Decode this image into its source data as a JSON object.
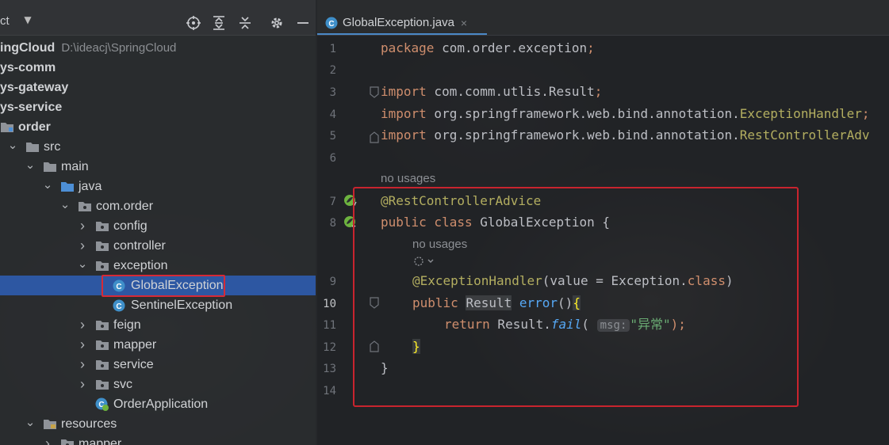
{
  "project_panel": {
    "title": "ct",
    "tree": [
      {
        "label": "ingCloud",
        "hint": "D:\\ideacj\\SpringCloud",
        "indent": 0,
        "arrow": "",
        "icon": "",
        "bold": true
      },
      {
        "label": "ys-comm",
        "indent": 0,
        "arrow": "",
        "icon": "",
        "bold": true
      },
      {
        "label": "ys-gateway",
        "indent": 0,
        "arrow": "",
        "icon": "",
        "bold": true
      },
      {
        "label": "ys-service",
        "indent": 0,
        "arrow": "",
        "icon": "",
        "bold": true
      },
      {
        "label": "order",
        "indent": 0,
        "arrow": "",
        "icon": "module",
        "bold": true
      },
      {
        "label": "src",
        "indent": 1,
        "arrow": "down",
        "icon": "folder"
      },
      {
        "label": "main",
        "indent": 2,
        "arrow": "down",
        "icon": "folder"
      },
      {
        "label": "java",
        "indent": 3,
        "arrow": "down",
        "icon": "folder-blue"
      },
      {
        "label": "com.order",
        "indent": 4,
        "arrow": "down",
        "icon": "package"
      },
      {
        "label": "config",
        "indent": 5,
        "arrow": "right",
        "icon": "package"
      },
      {
        "label": "controller",
        "indent": 5,
        "arrow": "right",
        "icon": "package"
      },
      {
        "label": "exception",
        "indent": 5,
        "arrow": "down",
        "icon": "package"
      },
      {
        "label": "GlobalException",
        "indent": 6,
        "arrow": "",
        "icon": "class",
        "selected": true
      },
      {
        "label": "SentinelException",
        "indent": 6,
        "arrow": "",
        "icon": "class"
      },
      {
        "label": "feign",
        "indent": 5,
        "arrow": "right",
        "icon": "package"
      },
      {
        "label": "mapper",
        "indent": 5,
        "arrow": "right",
        "icon": "package"
      },
      {
        "label": "service",
        "indent": 5,
        "arrow": "right",
        "icon": "package"
      },
      {
        "label": "svc",
        "indent": 5,
        "arrow": "right",
        "icon": "package"
      },
      {
        "label": "OrderApplication",
        "indent": 5,
        "arrow": "",
        "icon": "spring-class"
      },
      {
        "label": "resources",
        "indent": 2,
        "arrow": "down",
        "icon": "folder-res"
      },
      {
        "label": "mapper",
        "indent": 3,
        "arrow": "right",
        "icon": "package"
      }
    ],
    "header_icons": [
      "locate-icon",
      "expand-all-icon",
      "collapse-all-icon",
      "settings-gear-icon",
      "hide-panel-icon"
    ]
  },
  "editor": {
    "tab": {
      "label": "GlobalException.java",
      "close": "×"
    },
    "current_line": 10,
    "usage_hints": [
      "no usages",
      "no usages"
    ],
    "lines": {
      "l1": {
        "kw": "package",
        "rest": " com.order.exception",
        "semi": ";"
      },
      "l3": {
        "kw": "import",
        "rest": " com.comm.utlis.Result",
        "semi": ";"
      },
      "l4": {
        "kw": "import",
        "rest": " org.springframework.web.bind.annotation.",
        "cls": "ExceptionHandler",
        "semi": ";"
      },
      "l5": {
        "kw": "import",
        "rest": " org.springframework.web.bind.annotation.",
        "cls": "RestControllerAdv"
      },
      "l7": {
        "ann": "@RestControllerAdvice"
      },
      "l8": {
        "kw1": "public",
        "kw2": " class",
        "rest": " GlobalException {"
      },
      "l9": {
        "ann": "@ExceptionHandler",
        "open": "(",
        "param": "value = Exception.",
        "kw": "class",
        "close": ")"
      },
      "l10": {
        "kw": "public",
        "type": "Result",
        "fn": "error",
        "parens": "()",
        "brace": "{"
      },
      "l11": {
        "kw": "return",
        "obj": " Result.",
        "fn": "fail",
        "open": "(",
        "hint": "msg:",
        "str": "\"异常\"",
        "close": ");"
      },
      "l12": {
        "brace": "}"
      },
      "l13": {
        "brace": "}"
      }
    },
    "line_numbers": [
      "1",
      "2",
      "3",
      "4",
      "5",
      "6",
      "7",
      "8",
      "9",
      "10",
      "11",
      "12",
      "13",
      "14"
    ]
  }
}
